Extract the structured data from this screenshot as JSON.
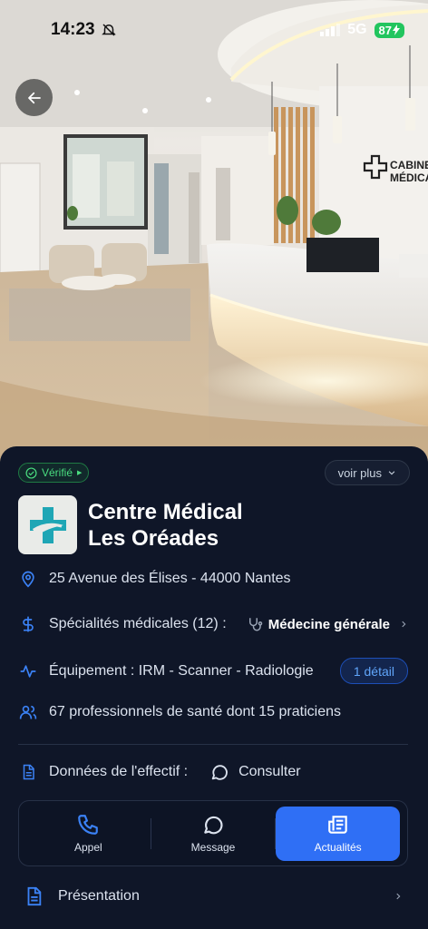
{
  "status_bar": {
    "time": "14:23",
    "network": "5G",
    "battery": "87"
  },
  "badges": {
    "verified": "Vérifié",
    "voir_plus": "voir plus"
  },
  "center": {
    "name_line1": "Centre Médical",
    "name_line2": "Les Oréades"
  },
  "address": "25 Avenue des Élises - 44000 Nantes",
  "specialties": {
    "label": "Spécialités médicales (12) :",
    "value": "Médecine générale"
  },
  "equipment": {
    "label": "Équipement :  IRM - Scanner - Radiologie",
    "detail_button": "1 détail"
  },
  "staff": "67 professionnels de santé dont 15 praticiens",
  "workforce": {
    "label": "Données de l'effectif :",
    "action": "Consulter"
  },
  "actions": [
    {
      "label": "Appel",
      "icon": "phone-icon"
    },
    {
      "label": "Message",
      "icon": "message-icon"
    },
    {
      "label": "Actualités",
      "icon": "newspaper-icon"
    }
  ],
  "presentation": "Présentation",
  "hero_sign": {
    "line1": "CABINET",
    "line2": "MÉDICAL"
  },
  "colors": {
    "accent": "#2f6ff5",
    "verified": "#4ade80",
    "icon_blue": "#3b82f6",
    "sheet_bg": "#0f1628"
  }
}
